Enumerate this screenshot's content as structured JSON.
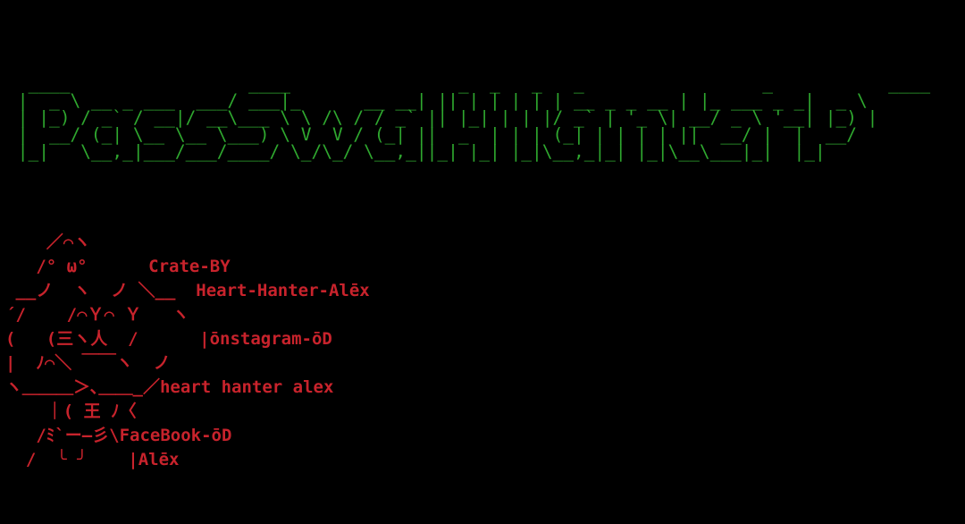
{
  "terminal": {
    "banner_lines": [
      "  ____                 ____                _  _   _   _                 _           ____  ",
      " |  _ \\ __ _ ___  ___/ ___|_      __ __| || | | | | | __ _ _ __ | |_ ___ _ _|  _ \\ ",
      " | |_) / _` / __|/ __\\___ \\ \\ /\\ / / _` || |_| | | |/ _` | '_ \\| __/ _ \\ '__| |_) |",
      " |  __/ (_| \\__ \\__ \\___) \\ V  V / (_| ||  _  | | | (_| | | | | ||  __/ |  |  __/ ",
      " |_|   \\__,_|___/___/____/ \\_/\\_/ \\__,_||_| |_| |_|\\__,_|_| |_|\\__\\___|_|  |_|    "
    ],
    "banner_color": "#2fa82f",
    "art_color": "#c8232c",
    "art_lines": [
      "    ／⌒ヽ",
      "   /° ω°      Crate-BY",
      " __ノ  ヽ  ノ ＼__  Heart-Hanter-Alēx",
      "´/    /⌒Ｙ⌒ Ｙ   ヽ",
      "(   (三ヽ人  /      |ōnstagram-ōD",
      "|  ﾉ⌒＼ ￣￣ヽ  ノ",
      "ヽ＿＿＿＞､＿＿_／heart hanter alex",
      "    ｜( 王 ﾉ〈",
      "   /ﾐ`ー―彡\\FaceBook-ōD",
      "  /  ╰ ╯    |Alēx"
    ]
  }
}
